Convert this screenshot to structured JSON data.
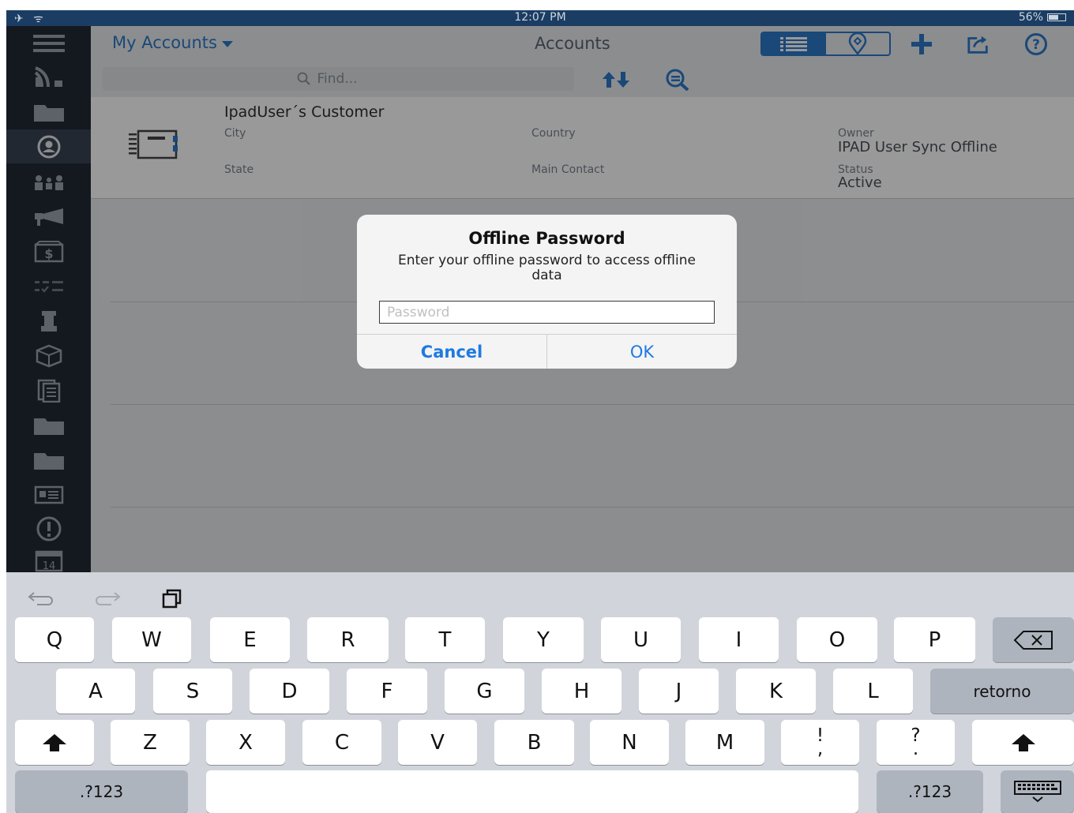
{
  "status_bar": {
    "left": "✈ ᯤ",
    "time": "12:07 PM",
    "battery": "56%"
  },
  "sidebar": {
    "items": [
      {
        "icon": "menu-icon"
      },
      {
        "icon": "feed-icon"
      },
      {
        "icon": "folder-icon"
      },
      {
        "icon": "accounts-icon",
        "active": true
      },
      {
        "icon": "contacts-icon"
      },
      {
        "icon": "campaign-icon"
      },
      {
        "icon": "money-icon"
      },
      {
        "icon": "tasks-icon"
      },
      {
        "icon": "chess-icon"
      },
      {
        "icon": "product-box-icon"
      },
      {
        "icon": "documents-icon"
      },
      {
        "icon": "folder-icon"
      },
      {
        "icon": "folder-icon"
      },
      {
        "icon": "card-icon"
      },
      {
        "icon": "alert-icon"
      },
      {
        "icon": "calendar-icon",
        "label": "14"
      }
    ]
  },
  "header": {
    "dropdown_label": "My Accounts",
    "title": "Accounts",
    "view_modes": [
      "list-icon",
      "map-pin-icon"
    ],
    "actions": [
      "add-icon",
      "share-icon",
      "help-icon"
    ]
  },
  "search": {
    "placeholder": "Find..."
  },
  "record": {
    "name": "IpadUser´s Customer",
    "fields": {
      "city_label": "City",
      "country_label": "Country",
      "owner_label": "Owner",
      "owner_value": "IPAD User Sync Offline",
      "state_label": "State",
      "main_contact_label": "Main Contact",
      "status_label": "Status",
      "status_value": "Active"
    }
  },
  "dialog": {
    "title": "Offline Password",
    "message": "Enter your offline password to access offline data",
    "input_placeholder": "Password",
    "cancel_label": "Cancel",
    "ok_label": "OK"
  },
  "keyboard": {
    "row1": [
      "Q",
      "W",
      "E",
      "R",
      "T",
      "Y",
      "U",
      "I",
      "O",
      "P"
    ],
    "row2": [
      "A",
      "S",
      "D",
      "F",
      "G",
      "H",
      "J",
      "K",
      "L"
    ],
    "row2_return": "retorno",
    "row3": [
      "Z",
      "X",
      "C",
      "V",
      "B",
      "N",
      "M"
    ],
    "row3_punct": [
      {
        "top": "!",
        "bottom": ","
      },
      {
        "top": "?",
        "bottom": "."
      }
    ],
    "numbers_label": ".?123"
  },
  "colors": {
    "accent": "#2c79c8",
    "sidebar": "#222a35",
    "statusbar": "#1b3d63",
    "dialog_button": "#1f7ae0"
  }
}
